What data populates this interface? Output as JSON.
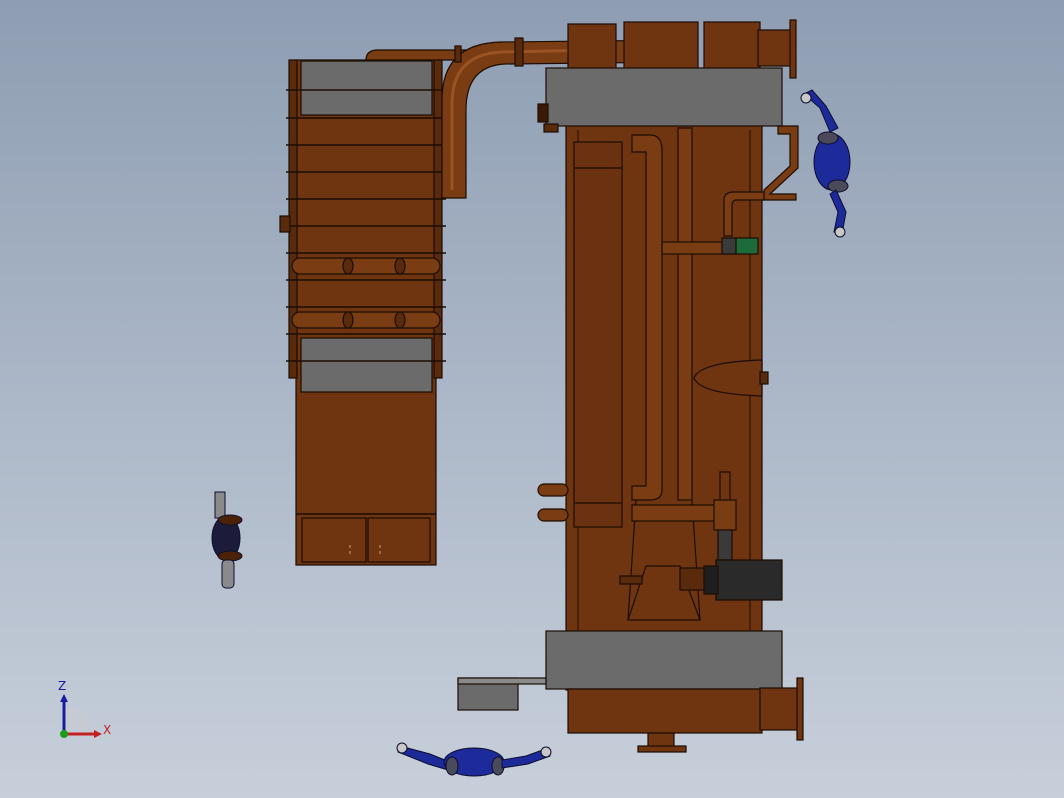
{
  "triad": {
    "z_label": "Z",
    "x_label": "X",
    "z_color": "#1b1b9e",
    "x_color": "#c42020",
    "y_color": "#1a9e1a"
  },
  "colors": {
    "background_top": "#8e9db2",
    "background_bottom": "#c7cfda",
    "body": "#6e3510",
    "body_dark": "#4a2208",
    "pipe": "#7a3c12",
    "pipe_highlight": "#9a5424",
    "steel_plate": "#6b6b6b",
    "outline": "#1c0d03",
    "figure_blue": "#1c2a9a",
    "motor": "#2a2a2a",
    "valve_green": "#1d6a3a"
  }
}
